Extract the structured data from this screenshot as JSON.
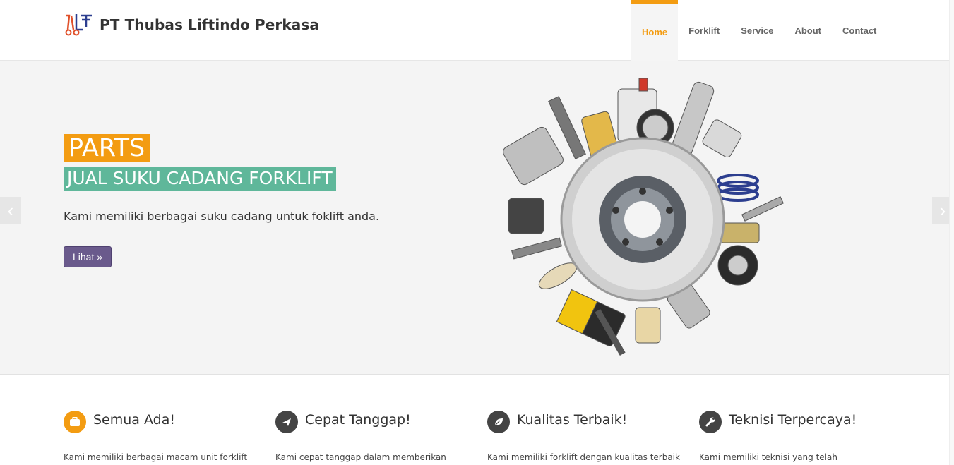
{
  "header": {
    "brand": "PT Thubas Liftindo Perkasa",
    "logo_icon": "forklift-logo-icon",
    "nav": [
      {
        "label": "Home",
        "active": true
      },
      {
        "label": "Forklift",
        "active": false
      },
      {
        "label": "Service",
        "active": false
      },
      {
        "label": "About",
        "active": false
      },
      {
        "label": "Contact",
        "active": false
      }
    ]
  },
  "hero": {
    "tag": "PARTS",
    "subtitle": "JUAL SUKU CADANG FORKLIFT",
    "text": "Kami memiliki berbagai suku cadang untuk foklift anda.",
    "button": "Lihat »",
    "prev_arrow": "‹",
    "next_arrow": "›",
    "image_icon": "auto-parts-icon"
  },
  "features": [
    {
      "icon": "briefcase-icon",
      "title": "Semua Ada!",
      "desc": "Kami memiliki berbagai macam unit forklift",
      "color": "#f39c12"
    },
    {
      "icon": "airplane-icon",
      "title": "Cepat Tanggap!",
      "desc": "Kami cepat tanggap dalam memberikan",
      "color": "#444444"
    },
    {
      "icon": "leaf-icon",
      "title": "Kualitas Terbaik!",
      "desc": "Kami memiliki forklift dengan kualitas terbaik",
      "color": "#444444"
    },
    {
      "icon": "wrench-icon",
      "title": "Teknisi Terpercaya!",
      "desc": "Kami memiliki teknisi yang telah",
      "color": "#444444"
    }
  ],
  "colors": {
    "accent": "#f39c12",
    "teal": "#5fb79a",
    "button": "#6a5a8c"
  }
}
